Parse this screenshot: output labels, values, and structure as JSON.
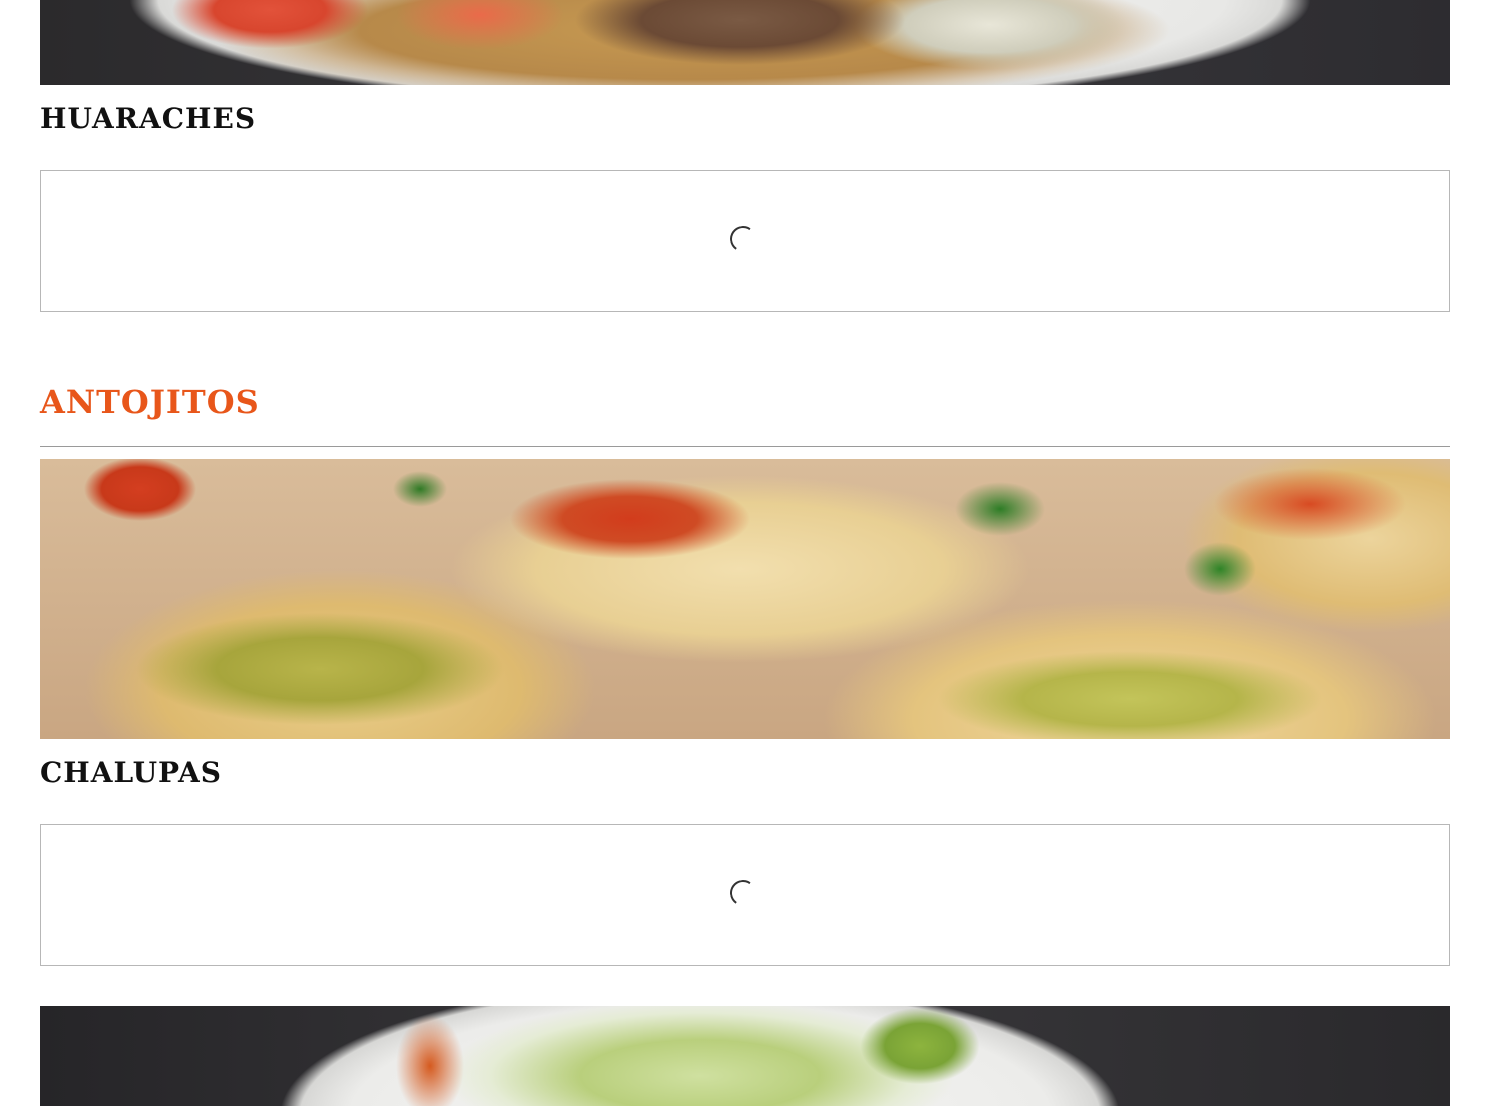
{
  "menu": {
    "items": [
      {
        "title": "HUARACHES"
      },
      {
        "title": "CHALUPAS"
      }
    ],
    "sections": [
      {
        "title": "ANTOJITOS"
      }
    ],
    "colors": {
      "section_title": "#e8561a",
      "item_title": "#111111",
      "loader_border": "#b7b7b7",
      "spinner": "#333333"
    },
    "icons": {
      "loading": "loading-spinner-icon"
    }
  }
}
